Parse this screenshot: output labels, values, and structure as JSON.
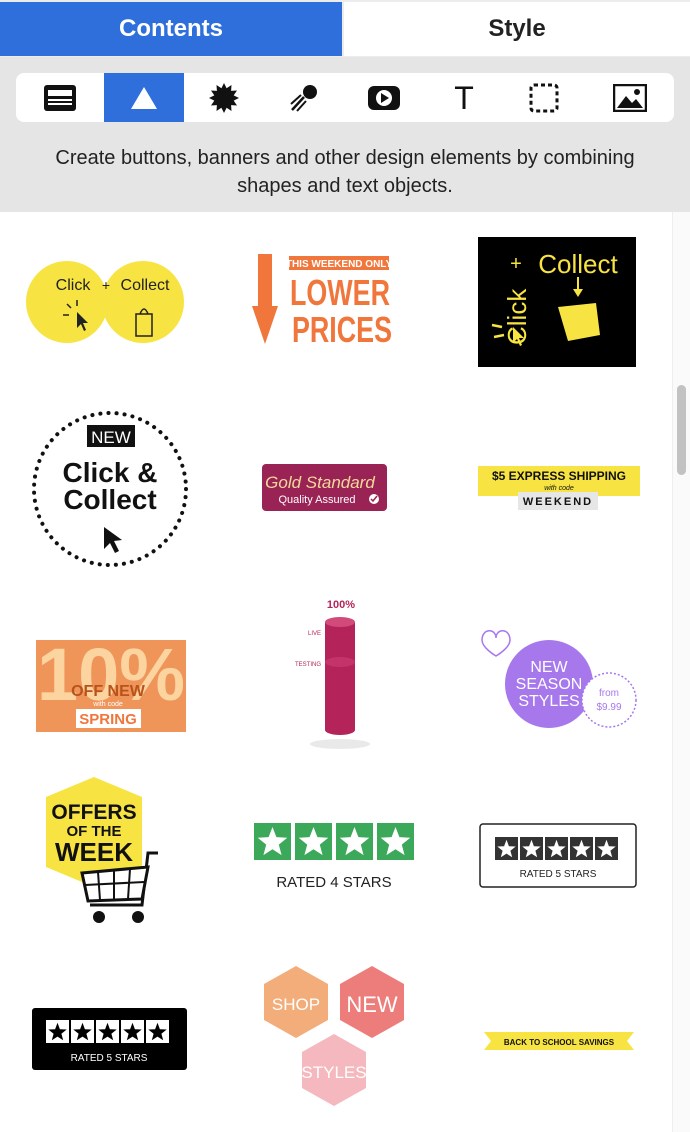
{
  "tabs": {
    "contents": "Contents",
    "style": "Style"
  },
  "toolbar": {
    "tools": [
      {
        "name": "text-block-icon"
      },
      {
        "name": "triangle-shape-icon"
      },
      {
        "name": "starburst-icon"
      },
      {
        "name": "comet-icon"
      },
      {
        "name": "video-icon"
      },
      {
        "name": "text-tool-icon"
      },
      {
        "name": "selection-frame-icon"
      },
      {
        "name": "image-icon"
      }
    ],
    "selected_index": 1
  },
  "description": "Create buttons, banners and other design elements by combining shapes and text objects.",
  "colors": {
    "accent": "#2f6fdc",
    "yellow": "#f7e442",
    "orange": "#f0763c",
    "purple": "#a678ec",
    "green": "#3ca85a",
    "pink": "#b4245a"
  },
  "elements": {
    "click_collect_circles": {
      "left": "Click",
      "plus": "+",
      "right": "Collect"
    },
    "lower_prices": {
      "top": "THIS WEEKEND ONLY",
      "line1": "LOWER",
      "line2": "PRICES"
    },
    "click_collect_black": {
      "plus": "+",
      "collect": "Collect",
      "click": "Click"
    },
    "new_click_collect": {
      "badge": "NEW",
      "line1": "Click &",
      "line2": "Collect"
    },
    "gold_standard": {
      "line1": "Gold Standard",
      "line2": "Quality Assured"
    },
    "express_shipping": {
      "line1": "$5 EXPRESS SHIPPING",
      "line2": "with code",
      "code": "WEEKEND"
    },
    "ten_percent": {
      "big": "10%",
      "off": "OFF NEW",
      "with": "with code",
      "code": "SPRING"
    },
    "cylinder": {
      "top": "100%",
      "live": "LIVE",
      "testing": "TESTING"
    },
    "new_season": {
      "line1": "NEW",
      "line2": "SEASON",
      "line3": "STYLES",
      "from": "from",
      "price": "$9.99"
    },
    "offers_week": {
      "line1": "OFFERS",
      "line2": "OF THE",
      "line3": "WEEK"
    },
    "rated_4": {
      "label": "RATED 4 STARS",
      "stars": 4
    },
    "rated_5_outline": {
      "label": "RATED 5 STARS",
      "stars": 5
    },
    "rated_5_black": {
      "label": "RATED 5 STARS",
      "stars": 5
    },
    "hexagons": {
      "shop": "SHOP",
      "new": "NEW",
      "styles": "STYLES"
    },
    "back_to_school": {
      "label": "BACK TO SCHOOL SAVINGS"
    }
  }
}
